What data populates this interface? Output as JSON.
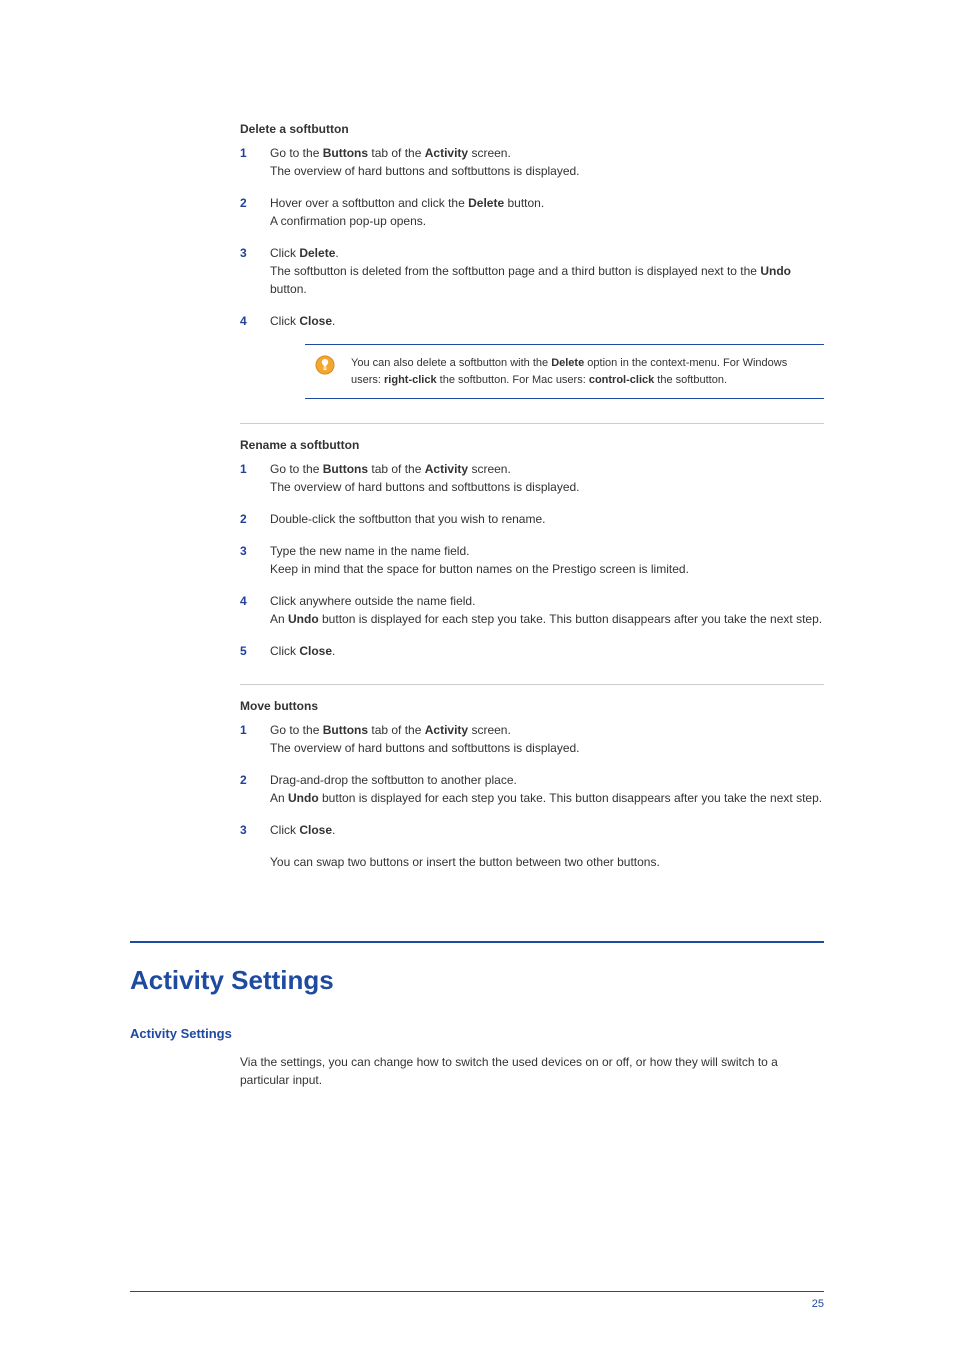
{
  "section1": {
    "heading": "Delete a softbutton",
    "steps": [
      "Go to the <b>Buttons</b> tab of the <b>Activity</b> screen.<br>The overview of hard buttons and softbuttons is displayed.",
      "Hover over a softbutton and click the <b>Delete</b> button.<br>A confirmation pop-up opens.",
      "Click <b>Delete</b>.<br>The softbutton is deleted from the softbutton page and a third button is displayed next to the <b>Undo</b> button.",
      "Click <b>Close</b>."
    ],
    "tip": "You can also delete a softbutton with the <b>Delete</b> option in the context-menu. For Windows users: <b>right-click</b> the softbutton. For Mac users: <b>control-click</b> the softbutton."
  },
  "section2": {
    "heading": "Rename a softbutton",
    "steps": [
      "Go to the <b>Buttons</b> tab of the <b>Activity</b> screen.<br>The overview of hard buttons and softbuttons is displayed.",
      "Double-click the softbutton that you wish to rename.",
      "Type the new name in the name field.<br>Keep in mind that the space for button names on the Prestigo screen is limited.",
      "Click anywhere outside the name field.<br>An <b>Undo</b> button is displayed for each step you take. This button disappears after you take the next step.",
      "Click <b>Close</b>."
    ]
  },
  "section3": {
    "heading": "Move buttons",
    "steps": [
      "Go to the <b>Buttons</b> tab of the <b>Activity</b> screen.<br>The overview of hard buttons and softbuttons is displayed.",
      "Drag-and-drop the softbutton to another place.<br>An <b>Undo</b> button is displayed for each step you take. This button disappears after you take the next step.",
      "Click <b>Close</b>."
    ],
    "note": "You can swap two buttons or insert the button between two other buttons."
  },
  "chapter": {
    "title": "Activity Settings",
    "subheading": "Activity Settings",
    "intro": "Via the settings, you can change how to switch the used devices on or off, or how they will switch to a particular input."
  },
  "page_number": "25"
}
